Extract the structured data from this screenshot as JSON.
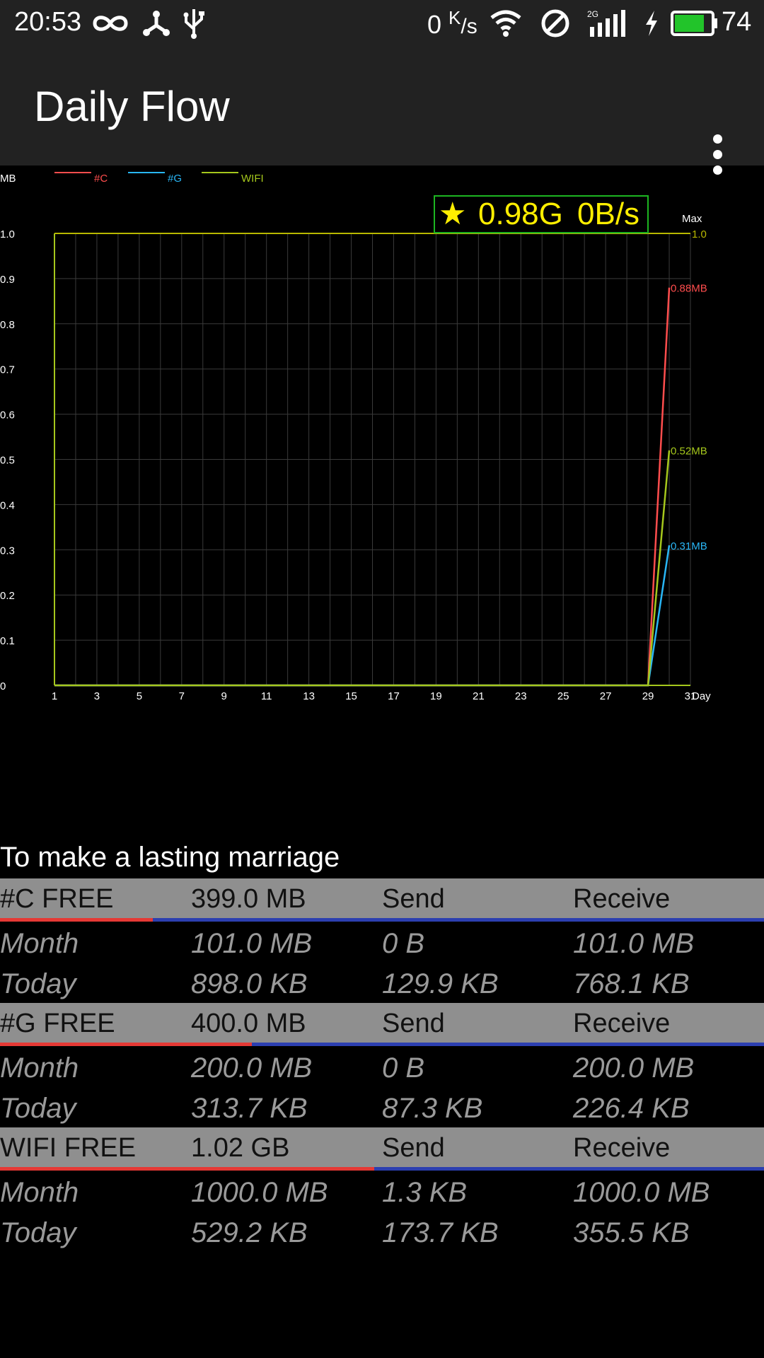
{
  "status_bar": {
    "time": "20:53",
    "net_speed_value": "0",
    "net_speed_unit_k": "K",
    "net_speed_unit_s": "/s",
    "battery_level": "74",
    "icons": [
      "infinity-icon",
      "usb-tether-icon",
      "usb-icon",
      "wifi-icon",
      "do-not-disturb-icon",
      "signal-2g-icon",
      "charging-icon",
      "battery-icon"
    ],
    "battery_color": "#22c42a"
  },
  "app_bar": {
    "title": "Daily Flow",
    "menu_icon": "overflow-menu-icon"
  },
  "chart_data": {
    "type": "line",
    "ylabel": "MB",
    "xlabel": "Day",
    "ylim": [
      0,
      1.0
    ],
    "xlim": [
      1,
      31
    ],
    "y_ticks": [
      "0",
      "0.1",
      "0.2",
      "0.3",
      "0.4",
      "0.5",
      "0.6",
      "0.7",
      "0.8",
      "0.9",
      "1.0"
    ],
    "x_ticks": [
      "1",
      "3",
      "5",
      "7",
      "9",
      "11",
      "13",
      "15",
      "17",
      "19",
      "21",
      "23",
      "25",
      "27",
      "29",
      "31"
    ],
    "legend": [
      "#C",
      "#G",
      "WIFI"
    ],
    "legend_position": "top-left",
    "grid": true,
    "max_label": "Max",
    "max_value_label": "1.0",
    "badge": {
      "star": "★",
      "total": "0.98G",
      "speed": "0B/s"
    },
    "series": [
      {
        "name": "#C",
        "color": "#ff4d4d",
        "points": [
          [
            1,
            0
          ],
          [
            29,
            0
          ],
          [
            30,
            0.88
          ]
        ],
        "end_label": "0.88MB"
      },
      {
        "name": "#G",
        "color": "#29b6f6",
        "points": [
          [
            1,
            0
          ],
          [
            29,
            0
          ],
          [
            30,
            0.31
          ]
        ],
        "end_label": "0.31MB"
      },
      {
        "name": "WIFI",
        "color": "#a5c71c",
        "points": [
          [
            1,
            0
          ],
          [
            29,
            0
          ],
          [
            30,
            0.52
          ]
        ],
        "end_label": "0.52MB"
      }
    ],
    "max_line_color": "#b8b800"
  },
  "stats": {
    "subtitle": "To make a lasting marriage",
    "columns": {
      "send": "Send",
      "receive": "Receive"
    },
    "sections": [
      {
        "name": "#C FREE",
        "free": "399.0 MB",
        "used_fraction": 0.2,
        "month": {
          "label": "Month",
          "total": "101.0 MB",
          "send": "0 B",
          "receive": "101.0 MB"
        },
        "today": {
          "label": "Today",
          "total": "898.0 KB",
          "send": "129.9 KB",
          "receive": "768.1 KB"
        }
      },
      {
        "name": "#G FREE",
        "free": "400.0 MB",
        "used_fraction": 0.33,
        "month": {
          "label": "Month",
          "total": "200.0 MB",
          "send": "0 B",
          "receive": "200.0 MB"
        },
        "today": {
          "label": "Today",
          "total": "313.7 KB",
          "send": "87.3 KB",
          "receive": "226.4 KB"
        }
      },
      {
        "name": "WIFI FREE",
        "free": "1.02 GB",
        "used_fraction": 0.49,
        "month": {
          "label": "Month",
          "total": "1000.0 MB",
          "send": "1.3 KB",
          "receive": "1000.0 MB"
        },
        "today": {
          "label": "Today",
          "total": "529.2 KB",
          "send": "173.7 KB",
          "receive": "355.5 KB"
        }
      }
    ]
  }
}
